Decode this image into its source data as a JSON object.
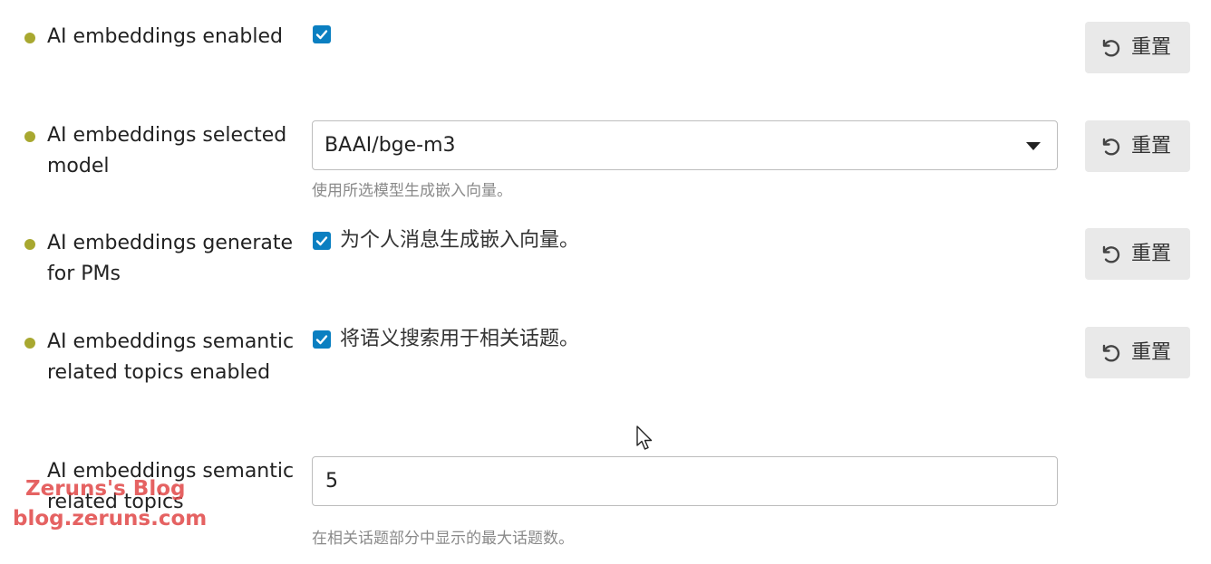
{
  "settings": [
    {
      "label": "AI embeddings enabled",
      "control": "checkbox",
      "checked": true,
      "checkbox_text": "",
      "reset_label": "重置"
    },
    {
      "label": "AI embeddings selected model",
      "control": "select",
      "value": "BAAI/bge-m3",
      "help": "使用所选模型生成嵌入向量。",
      "reset_label": "重置"
    },
    {
      "label": "AI embeddings generate for PMs",
      "control": "checkbox",
      "checked": true,
      "checkbox_text": "为个人消息生成嵌入向量。",
      "reset_label": "重置"
    },
    {
      "label": "AI embeddings semantic related topics enabled",
      "control": "checkbox",
      "checked": true,
      "checkbox_text": "将语义搜索用于相关话题。",
      "reset_label": "重置"
    },
    {
      "label": "AI embeddings semantic related topics",
      "control": "number-input",
      "value": "5",
      "help": "在相关话题部分中显示的最大话题数。"
    }
  ],
  "watermark": {
    "line1": "Zeruns's Blog",
    "line2": "blog.zeruns.com"
  },
  "colors": {
    "dot": "#a8a830",
    "checkbox": "#0a7fc1",
    "reset_bg": "#e9e9e9",
    "watermark": "#e14646"
  }
}
